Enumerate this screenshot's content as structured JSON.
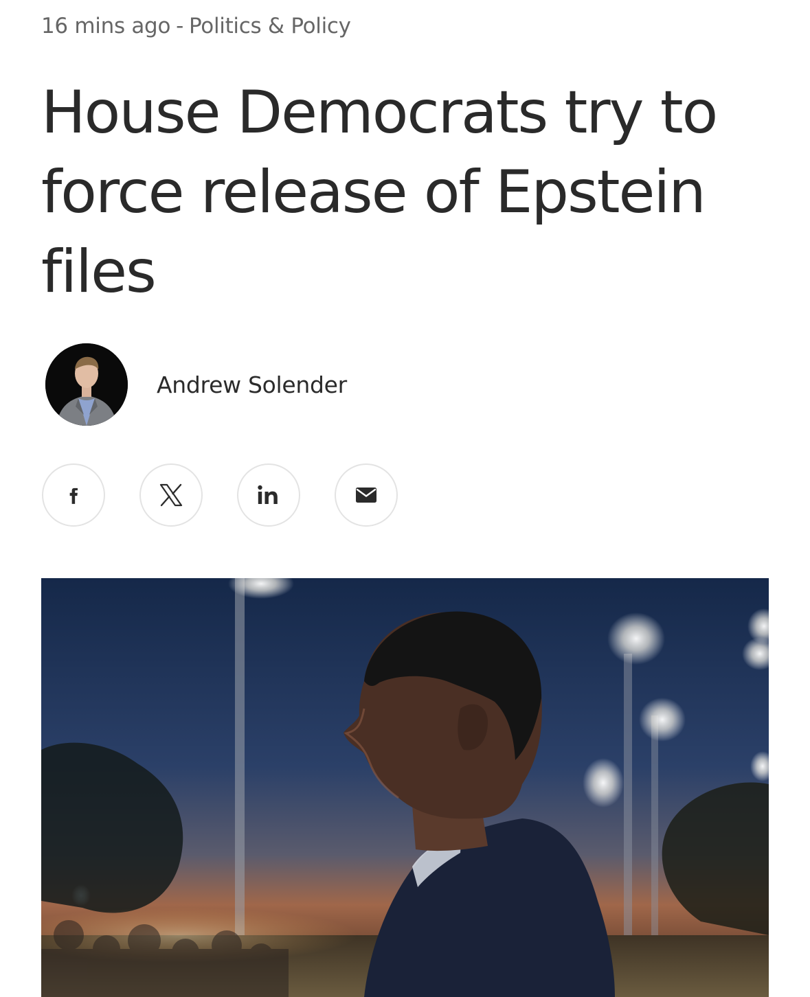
{
  "article": {
    "time_ago": "16 mins ago",
    "separator": "-",
    "category": "Politics & Policy",
    "headline": "House Democrats try to force release of Epstein files",
    "author": "Andrew Solender"
  },
  "share": [
    {
      "name": "facebook",
      "icon": "facebook-icon"
    },
    {
      "name": "x",
      "icon": "x-icon"
    },
    {
      "name": "linkedin",
      "icon": "linkedin-icon"
    },
    {
      "name": "email",
      "icon": "mail-icon"
    }
  ],
  "colors": {
    "meta_text": "#666666",
    "headline_text": "#2a2a2a",
    "share_border": "#e3e3e3",
    "icon_color": "#2b2b2b"
  }
}
